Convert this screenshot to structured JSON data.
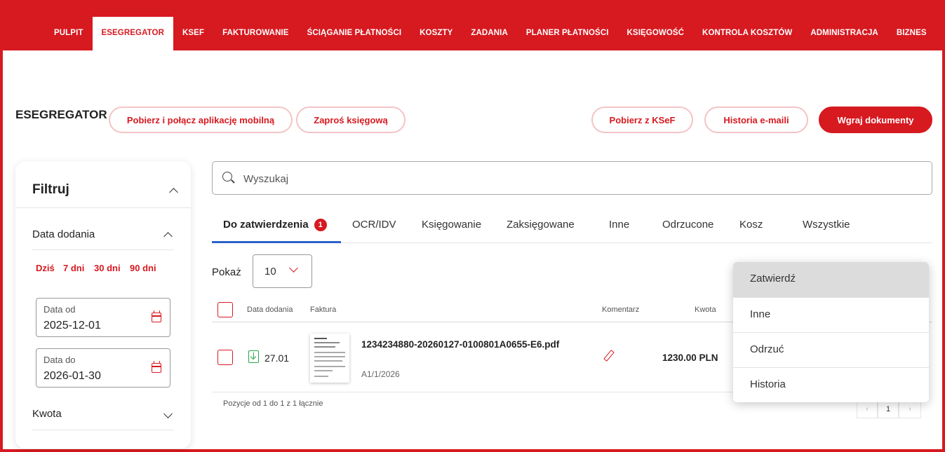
{
  "nav": {
    "items": [
      "PULPIT",
      "ESEGREGATOR",
      "KSEF",
      "FAKTUROWANIE",
      "ŚCIĄGANIE PŁATNOŚCI",
      "KOSZTY",
      "ZADANIA",
      "PLANER PŁATNOŚCI",
      "KSIĘGOWOŚĆ",
      "KONTROLA KOSZTÓW",
      "ADMINISTRACJA",
      "BIZNES"
    ],
    "active_index": 1
  },
  "header": {
    "title": "ESEGREGATOR",
    "btn_mobile": "Pobierz i połącz aplikację mobilną",
    "btn_accountant": "Zaproś księgową",
    "btn_ksef": "Pobierz z KSeF",
    "btn_email_history": "Historia e-maili",
    "btn_upload": "Wgraj dokumenty"
  },
  "filter": {
    "title": "Filtruj",
    "date_added_label": "Data dodania",
    "quick_ranges": [
      "Dziś",
      "7 dni",
      "30 dni",
      "90 dni"
    ],
    "date_from_label": "Data od",
    "date_from_value": "2025-12-01",
    "date_to_label": "Data do",
    "date_to_value": "2026-01-30",
    "amount_label": "Kwota"
  },
  "search": {
    "placeholder": "Wyszukaj"
  },
  "tabs": [
    {
      "label": "Do zatwierdzenia",
      "badge": "1"
    },
    {
      "label": "OCR/IDV"
    },
    {
      "label": "Księgowanie"
    },
    {
      "label": "Zaksięgowane"
    },
    {
      "label": "Inne"
    },
    {
      "label": "Odrzucone"
    },
    {
      "label": "Kosz"
    },
    {
      "label": "Wszystkie"
    }
  ],
  "page_size": {
    "label": "Pokaż",
    "value": "10"
  },
  "table": {
    "columns": [
      "Data dodania",
      "Faktura",
      "Komentarz",
      "Kwota"
    ],
    "rows": [
      {
        "date": "27.01",
        "filename": "1234234880-20260127-0100801A0655-E6.pdf",
        "number": "A1/1/2026",
        "amount": "1230.00 PLN"
      }
    ],
    "footer": "Pozycje od 1 do 1 z 1 łącznie",
    "pagination": {
      "prev": "‹",
      "current": "1",
      "next": "›"
    }
  },
  "menu": {
    "items": [
      "Zatwierdź",
      "Inne",
      "Odrzuć",
      "Historia"
    ]
  },
  "colors": {
    "brand": "#d71920",
    "tab_underline": "#2b62c8",
    "success": "#2aa44a"
  }
}
